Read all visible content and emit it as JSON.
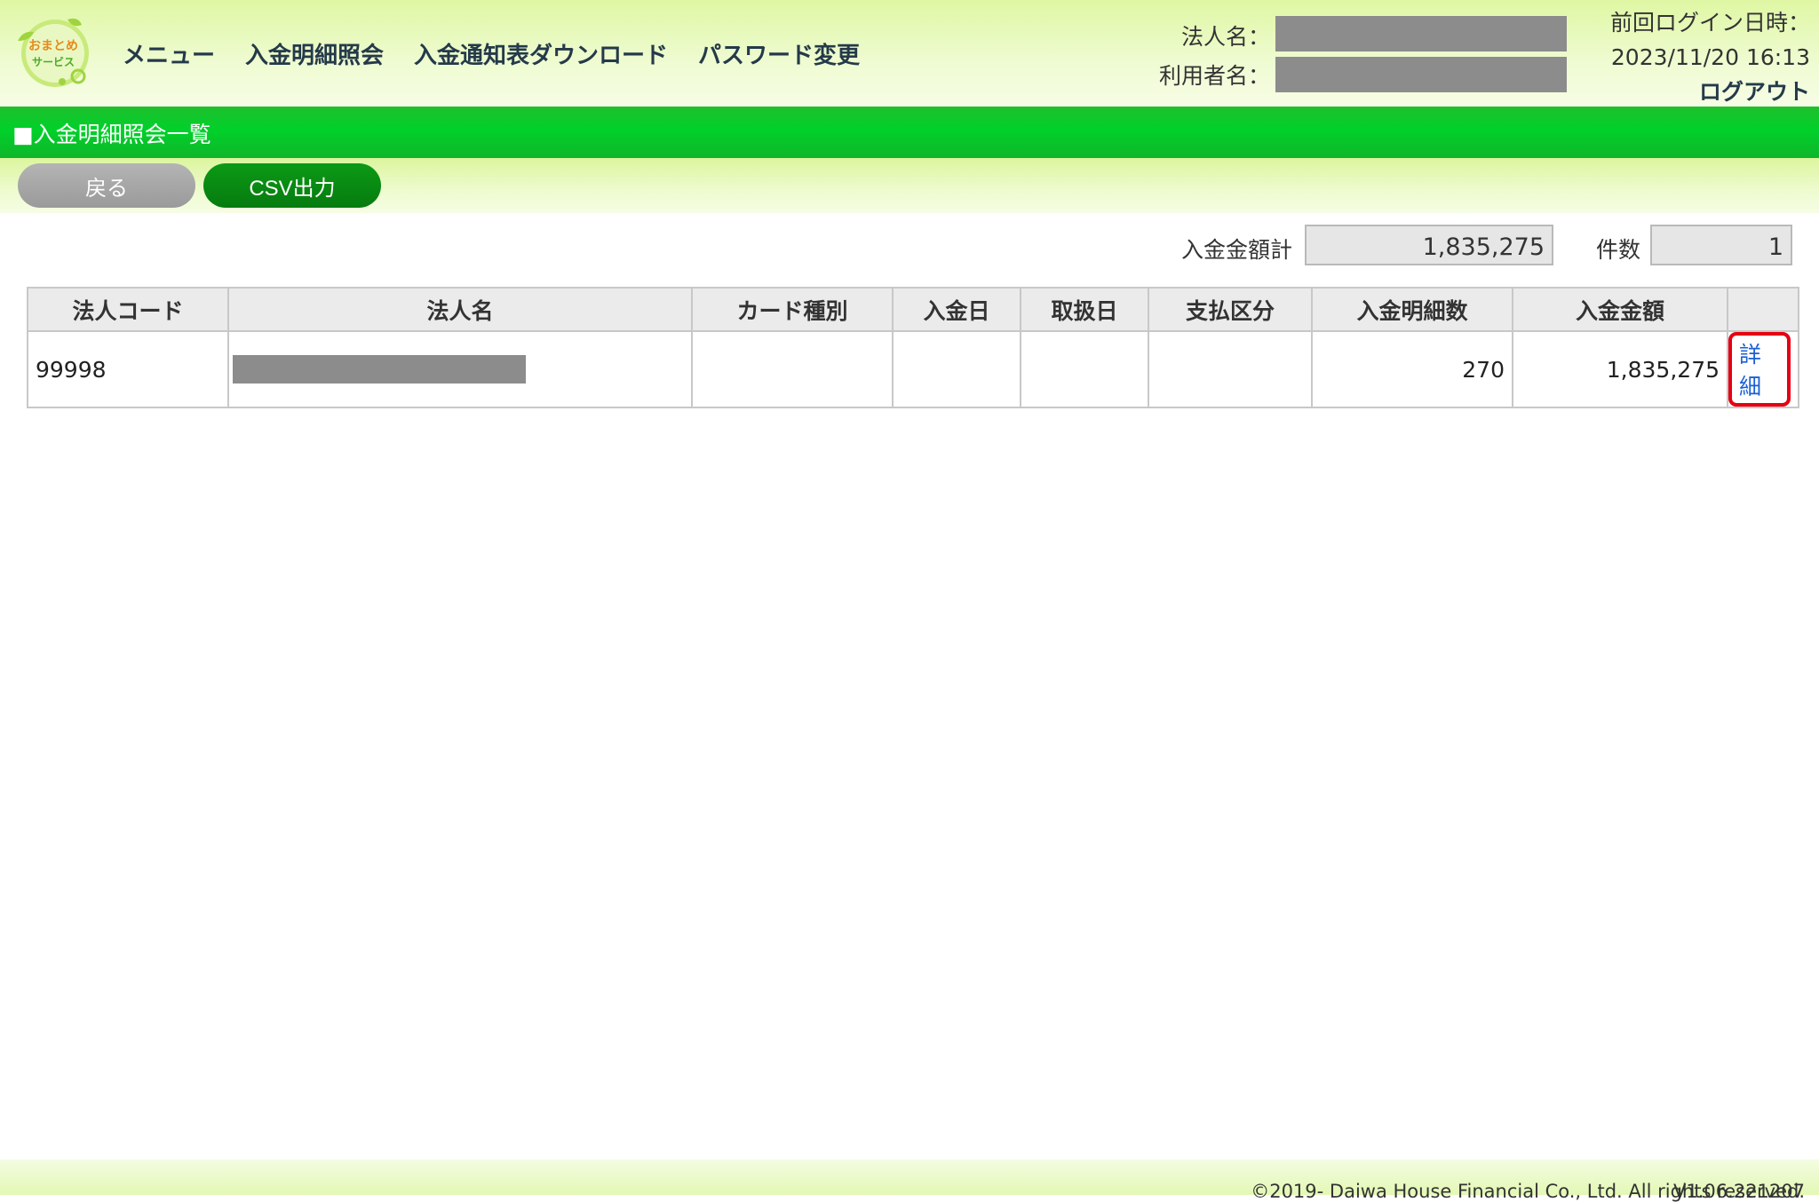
{
  "header": {
    "logo_text_line1": "おまとめ",
    "logo_text_line2": "サービス",
    "nav": [
      "メニュー",
      "入金明細照会",
      "入金通知表ダウンロード",
      "パスワード変更"
    ],
    "corp_label": "法人名：",
    "user_label": "利用者名：",
    "last_login_label": "前回ログイン日時：",
    "last_login_value": "2023/11/20 16:13",
    "logout": "ログアウト"
  },
  "title": "■入金明細照会一覧",
  "buttons": {
    "back": "戻る",
    "csv": "CSV出力"
  },
  "summary": {
    "total_label": "入金金額計",
    "total_value": "1,835,275",
    "count_label": "件数",
    "count_value": "1"
  },
  "table": {
    "headers": [
      "法人コード",
      "法人名",
      "カード種別",
      "入金日",
      "取扱日",
      "支払区分",
      "入金明細数",
      "入金金額",
      ""
    ],
    "rows": [
      {
        "corp_code": "99998",
        "card_type": "",
        "deposit_date": "",
        "handling_date": "",
        "payment_type": "",
        "detail_count": "270",
        "amount": "1,835,275",
        "detail_link": "詳細"
      }
    ]
  },
  "footer": {
    "version": "V1.06.221207",
    "copyright": "©2019- Daiwa House Financial Co., Ltd. All rights reserved."
  },
  "colors": {
    "title_bar": "#00d12a",
    "csv_button": "#067b0f",
    "back_button": "#9a9a9a",
    "link": "#1a5fd6",
    "highlight": "#e60012"
  }
}
